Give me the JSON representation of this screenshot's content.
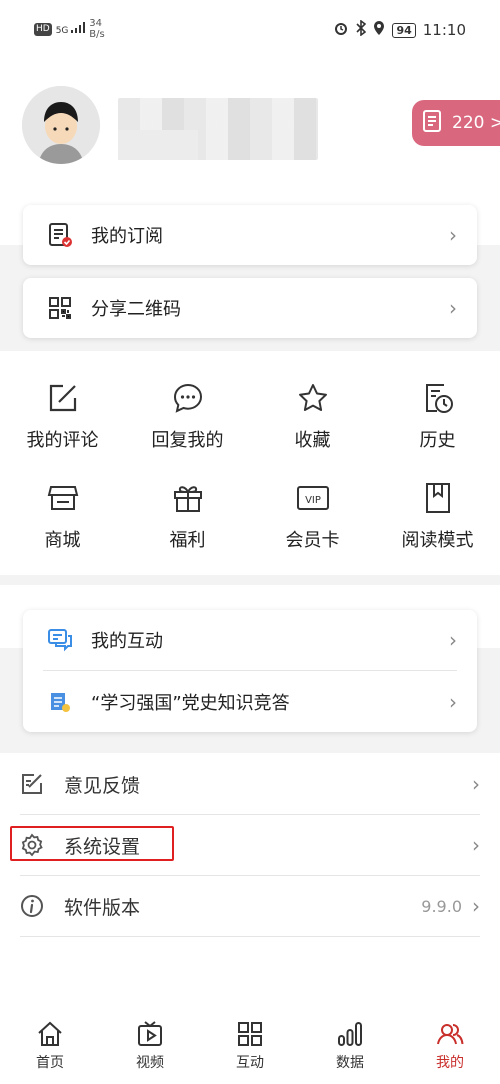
{
  "status_bar": {
    "hd": "HD",
    "signal": "5G",
    "speed_value": "34",
    "speed_unit": "B/s",
    "battery": "94",
    "time": "11:10"
  },
  "profile": {
    "points": "220 >"
  },
  "top_cards": [
    {
      "label": "我的订阅",
      "icon": "subscription-icon"
    },
    {
      "label": "分享二维码",
      "icon": "qr-code-icon"
    }
  ],
  "grid": [
    {
      "label": "我的评论",
      "icon": "edit-icon"
    },
    {
      "label": "回复我的",
      "icon": "chat-bubble-icon"
    },
    {
      "label": "收藏",
      "icon": "star-icon"
    },
    {
      "label": "历史",
      "icon": "history-icon"
    },
    {
      "label": "商城",
      "icon": "shop-icon"
    },
    {
      "label": "福利",
      "icon": "gift-icon"
    },
    {
      "label": "会员卡",
      "icon": "vip-card-icon"
    },
    {
      "label": "阅读模式",
      "icon": "bookmark-icon"
    }
  ],
  "interaction_card": [
    {
      "label": "我的互动",
      "icon": "message-icon"
    },
    {
      "label": "“学习强国”党史知识竞答",
      "icon": "quiz-icon"
    }
  ],
  "list": [
    {
      "label": "意见反馈",
      "icon": "feedback-icon",
      "value": ""
    },
    {
      "label": "系统设置",
      "icon": "gear-icon",
      "value": ""
    },
    {
      "label": "软件版本",
      "icon": "info-icon",
      "value": "9.9.0"
    }
  ],
  "tabs": [
    {
      "label": "首页",
      "icon": "home-icon"
    },
    {
      "label": "视频",
      "icon": "video-icon"
    },
    {
      "label": "互动",
      "icon": "grid-icon"
    },
    {
      "label": "数据",
      "icon": "bar-chart-icon"
    },
    {
      "label": "我的",
      "icon": "profile-icon",
      "active": true
    }
  ],
  "colors": {
    "accent": "#d9687f",
    "active_tab": "#c9302c",
    "highlight_box": "#e02020"
  }
}
